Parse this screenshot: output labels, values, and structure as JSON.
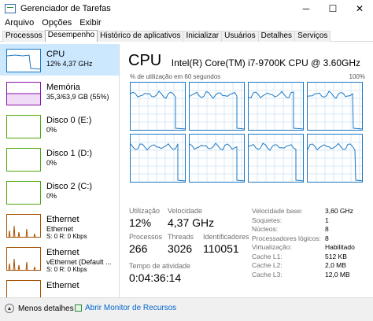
{
  "window": {
    "title": "Gerenciador de Tarefas",
    "controls": {
      "minimize": "─",
      "maximize": "☐",
      "close": "✕"
    }
  },
  "menu": [
    {
      "label": "Arquivo"
    },
    {
      "label": "Opções"
    },
    {
      "label": "Exibir"
    }
  ],
  "tabs": [
    {
      "label": "Processos"
    },
    {
      "label": "Desempenho"
    },
    {
      "label": "Histórico de aplicativos"
    },
    {
      "label": "Inicializar"
    },
    {
      "label": "Usuários"
    },
    {
      "label": "Detalhes"
    },
    {
      "label": "Serviços"
    }
  ],
  "active_tab": "Desempenho",
  "sidebar": {
    "items": [
      {
        "title": "CPU",
        "sub": "12% 4,37 GHz",
        "sub2": "",
        "color": "#1b77c4"
      },
      {
        "title": "Memória",
        "sub": "35,3/63,9 GB (55%)",
        "sub2": "",
        "color": "#8b12ae"
      },
      {
        "title": "Disco 0 (E:)",
        "sub": "0%",
        "sub2": "",
        "color": "#4da60c"
      },
      {
        "title": "Disco 1 (D:)",
        "sub": "0%",
        "sub2": "",
        "color": "#4da60c"
      },
      {
        "title": "Disco 2 (C:)",
        "sub": "0%",
        "sub2": "",
        "color": "#4da60c"
      },
      {
        "title": "Ethernet",
        "sub": "Ethernet",
        "sub2": "S: 0 R: 0 Kbps",
        "color": "#a74f01"
      },
      {
        "title": "Ethernet",
        "sub": "vEthernet (Default ...",
        "sub2": "S: 0 R: 0 Kbps",
        "color": "#a74f01"
      },
      {
        "title": "Ethernet",
        "sub": "",
        "sub2": "",
        "color": "#a74f01"
      }
    ]
  },
  "cpu": {
    "title": "CPU",
    "model": "Intel(R) Core(TM) i7-9700K CPU @ 3.60GHz",
    "graph_label": "% de utilização em 60 segundos",
    "graph_max": "100%",
    "stats": {
      "utilizacao_label": "Utilização",
      "utilizacao": "12%",
      "velocidade_label": "Velocidade",
      "velocidade": "4,37 GHz",
      "processos_label": "Processos",
      "processos": "266",
      "threads_label": "Threads",
      "threads": "3026",
      "identificadores_label": "Identificadores",
      "identificadores": "110051",
      "tempo_label": "Tempo de atividade",
      "tempo": "0:04:36:14"
    },
    "right_stats": [
      {
        "k": "Velocidade base:",
        "v": "3,60 GHz"
      },
      {
        "k": "Soquetes:",
        "v": "1"
      },
      {
        "k": "Núcleos:",
        "v": "8"
      },
      {
        "k": "Processadores lógicos:",
        "v": "8"
      },
      {
        "k": "Virtualização:",
        "v": "Habilitado"
      },
      {
        "k": "Cache L1:",
        "v": "512 KB"
      },
      {
        "k": "Cache L2:",
        "v": "2,0 MB"
      },
      {
        "k": "Cache L3:",
        "v": "12,0 MB"
      }
    ]
  },
  "footer": {
    "less_details": "Menos detalhes",
    "resource_monitor": "Abrir Monitor de Recursos"
  }
}
